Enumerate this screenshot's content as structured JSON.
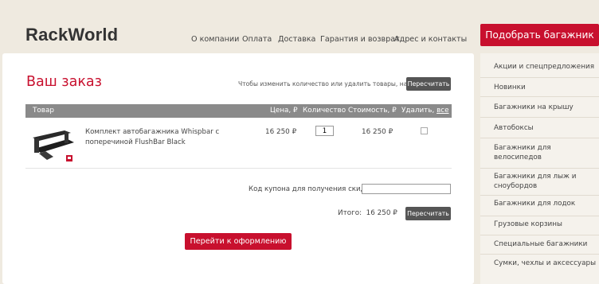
{
  "header": {
    "logo": "RackWorld",
    "nav": [
      "О компании",
      "Оплата",
      "Доставка",
      "Гарантия и возврат",
      "Адрес и контакты"
    ],
    "cta_label": "Подобрать багажник"
  },
  "cart": {
    "title": "Ваш заказ",
    "hint": "Чтобы изменить количество или удалить товары, нажмите",
    "recalc_label": "Пересчитать",
    "columns": {
      "product": "Товар",
      "price": "Цена, ₽",
      "quantity": "Количество",
      "cost": "Стоимость, ₽",
      "delete": "Удалить,",
      "delete_all": "все"
    },
    "items": [
      {
        "name": "Комплект автобагажника Whispbar с поперечиной FlushBar Black",
        "price": "16 250 ₽",
        "quantity": "1",
        "cost": "16 250 ₽",
        "image": "roof-rack-bars-image"
      }
    ],
    "coupon_label": "Код купона для получения скидки:",
    "coupon_value": "",
    "total_label": "Итого:",
    "total_value": "16 250 ₽",
    "recalc_bottom_label": "Пересчитать",
    "checkout_label": "Перейти к оформлению"
  },
  "sidebar": {
    "items": [
      "Акции и спецпредложения",
      "Новинки",
      "Багажники на крышу",
      "Автобоксы",
      "Багажники для велосипедов",
      "Багажники для лыж и сноубордов",
      "Багажники для лодок",
      "Грузовые корзины",
      "Специальные багажники",
      "Сумки, чехлы и аксессуары"
    ]
  },
  "colors": {
    "brand": "#c8102e",
    "page_bg": "#efeae0",
    "table_header": "#8a8a8a",
    "dark_button": "#555555"
  }
}
